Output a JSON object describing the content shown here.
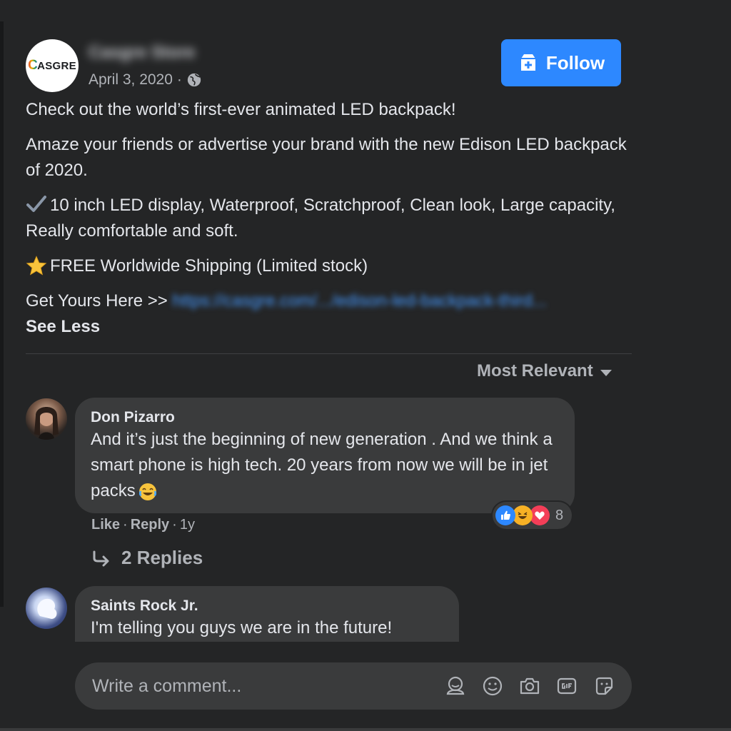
{
  "post": {
    "page_name": "Casgre Store",
    "logo_text": "ASGRE",
    "logo_initial": "C",
    "date": "April 3, 2020",
    "separator": "·",
    "follow_label": "Follow",
    "line1": "Check out the world’s first-ever animated LED backpack!",
    "line2": "Amaze your friends or advertise your brand with the new Edison LED backpack of 2020.",
    "line3": "10 inch LED display, Waterproof, Scratchproof, Clean look, Large capacity, Really comfortable and soft.",
    "line4": "FREE Worldwide Shipping (Limited stock)",
    "get_yours": "Get Yours Here >>",
    "link_text": "https://casgre.com/.../edison-led-backpack-third...",
    "see_less": "See Less"
  },
  "sort": {
    "label": "Most Relevant"
  },
  "comments": [
    {
      "author": "Don Pizarro",
      "text": "And it’s just the beginning of new generation . And we think a smart phone is high tech. 20 years from now we will be in jet packs",
      "reaction_count": "8",
      "like": "Like",
      "reply": "Reply",
      "time": "1y",
      "sep": "·",
      "replies_label": "2 Replies"
    },
    {
      "author": "Saints Rock Jr.",
      "text": "I'm telling you guys we are in the future!"
    }
  ],
  "composer": {
    "placeholder": "Write a comment..."
  },
  "icons": [
    "globe-icon",
    "follow-icon",
    "check-icon",
    "star-icon",
    "caret-down-icon",
    "like-reaction-icon",
    "haha-reaction-icon",
    "love-reaction-icon",
    "reply-arrow-icon",
    "avatar-icon",
    "emoji-icon",
    "camera-icon",
    "gif-icon",
    "sticker-icon"
  ],
  "colors": {
    "background": "#242526",
    "bubble": "#3a3b3c",
    "accent": "#2d88ff",
    "text": "#e4e6eb",
    "muted": "#b0b3b8"
  }
}
